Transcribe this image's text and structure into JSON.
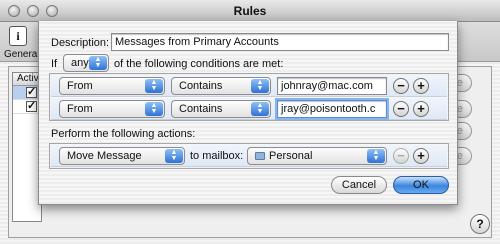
{
  "window": {
    "title": "Rules",
    "toolbar_label": "General",
    "toolbar_icon_glyph": "i"
  },
  "background": {
    "list_header": "Active",
    "side_buttons": [
      "le",
      "le",
      "Duplicate",
      "ve"
    ],
    "help": "?"
  },
  "sheet": {
    "description_label": "Description:",
    "description_value": "Messages from Primary Accounts",
    "if_label": "If",
    "match_value": "any",
    "match_suffix": "of the following conditions are met:",
    "conditions": [
      {
        "field": "From",
        "operator": "Contains",
        "value": "johnray@mac.com"
      },
      {
        "field": "From",
        "operator": "Contains",
        "value": "jray@poisontooth.c"
      }
    ],
    "actions_label": "Perform the following actions:",
    "action": {
      "type": "Move Message",
      "connector": "to mailbox:",
      "mailbox": "Personal"
    },
    "minus": "−",
    "plus": "+",
    "cancel_label": "Cancel",
    "ok_label": "OK"
  },
  "colors": {
    "accent": "#3b86e0",
    "selection": "#b8d0ee"
  }
}
